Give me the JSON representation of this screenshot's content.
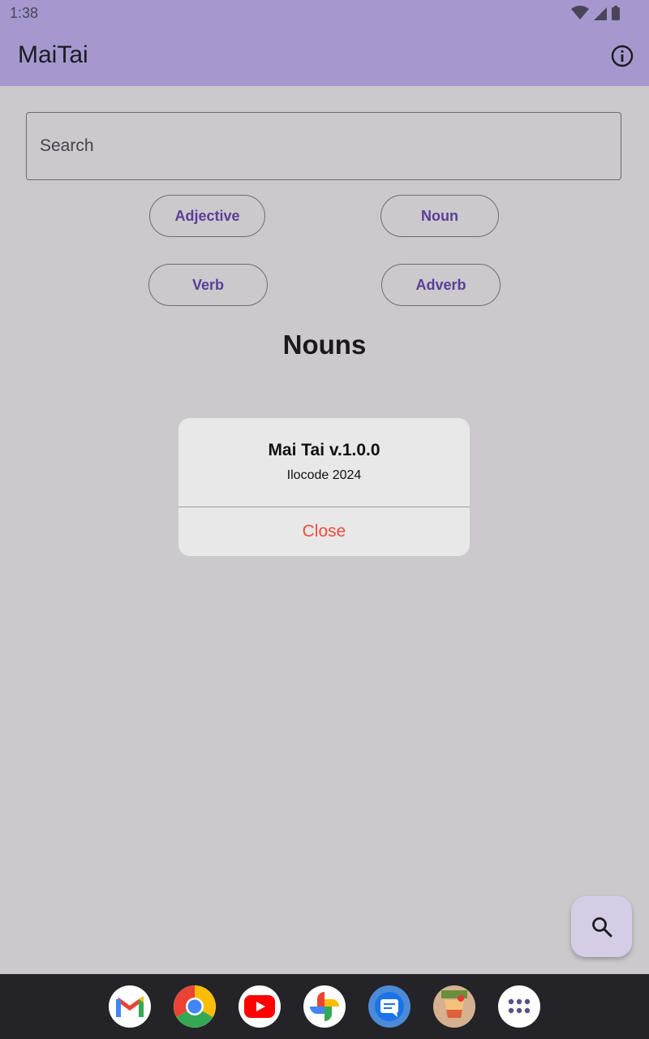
{
  "status_bar": {
    "time": "1:38"
  },
  "app_bar": {
    "title": "MaiTai"
  },
  "search": {
    "placeholder": "Search"
  },
  "filters": [
    {
      "label": "Adjective"
    },
    {
      "label": "Noun"
    },
    {
      "label": "Verb"
    },
    {
      "label": "Adverb"
    }
  ],
  "section_title": "Nouns",
  "dialog": {
    "title": "Mai Tai v.1.0.0",
    "subtitle": "Ilocode 2024",
    "close_label": "Close"
  },
  "fab": {
    "icon": "search-icon"
  },
  "dock": {
    "apps": [
      "gmail-icon",
      "chrome-icon",
      "youtube-icon",
      "photos-icon",
      "messages-icon",
      "maitai-app-icon",
      "app-drawer-icon"
    ]
  },
  "colors": {
    "app_bar": "#a698cf",
    "chip_text": "#5a3d99",
    "close_text": "#f04b37",
    "fab": "#d5cde6"
  }
}
